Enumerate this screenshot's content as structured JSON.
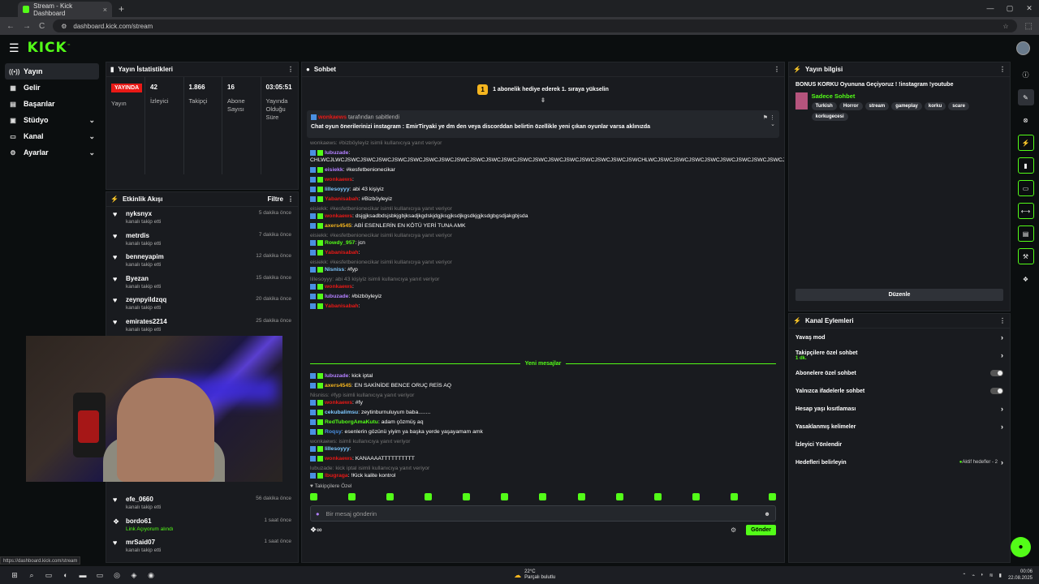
{
  "browser": {
    "tab_title": "Stream - Kick Dashboard",
    "tab_close": "×",
    "new_tab": "+",
    "url": "dashboard.kick.com/stream",
    "status_url": "https://dashboard.kick.com/stream",
    "nav_back": "←",
    "nav_forward": "→",
    "nav_reload": "C",
    "site_info": "⚙",
    "bookmark": "☆",
    "extensions": "⬚",
    "window_controls": [
      "—",
      "▢",
      "✕"
    ]
  },
  "topbar": {
    "menu_glyph": "☰",
    "logo": "KICK",
    "logo_tm": "™"
  },
  "sidebar": {
    "items": [
      {
        "label": "Yayın",
        "icon": "((•))",
        "active": true,
        "chevron": ""
      },
      {
        "label": "Gelir",
        "icon": "▦",
        "active": false,
        "chevron": ""
      },
      {
        "label": "Başarılar",
        "icon": "▤",
        "active": false,
        "chevron": ""
      },
      {
        "label": "Stüdyo",
        "icon": "▣",
        "active": false,
        "chevron": "⌄"
      },
      {
        "label": "Kanal",
        "icon": "▭",
        "active": false,
        "chevron": "⌄"
      },
      {
        "label": "Ayarlar",
        "icon": "⚙",
        "active": false,
        "chevron": "⌄"
      }
    ]
  },
  "stats_panel": {
    "title": "Yayın İstatistikleri",
    "menu_glyph": "⋮",
    "live_badge": "YAYINDA",
    "live_label": "Yayın",
    "stats": [
      {
        "value": "42",
        "label": "İzleyici"
      },
      {
        "value": "1.866",
        "label": "Takipçi"
      },
      {
        "value": "16",
        "label": "Abone Sayısı"
      },
      {
        "value": "03:05:51",
        "label": "Yayında Olduğu Süre"
      }
    ]
  },
  "activity": {
    "title": "Etkinlik Akışı",
    "filter": "Filtre",
    "menu_glyph": "⋮",
    "heart_glyph": "♥",
    "link_glyph": "❖",
    "items_top": [
      {
        "name": "nyksnyx",
        "sub": "kanalı takip etti",
        "time": "5 dakika önce"
      },
      {
        "name": "metrdis",
        "sub": "kanalı takip etti",
        "time": "7 dakika önce"
      },
      {
        "name": "benneyapim",
        "sub": "kanalı takip etti",
        "time": "12 dakika önce"
      },
      {
        "name": "Byezan",
        "sub": "kanalı takip etti",
        "time": "15 dakika önce"
      },
      {
        "name": "zeynpyildzqq",
        "sub": "kanalı takip etti",
        "time": "20 dakika önce"
      },
      {
        "name": "emirates2214",
        "sub": "kanalı takip etti",
        "time": "25 dakika önce"
      }
    ],
    "items_bottom": [
      {
        "name": "efe_0660",
        "sub": "kanalı takip etti",
        "time": "56 dakika önce",
        "link": false
      },
      {
        "name": "bordo61",
        "sub": "Link Açıyorum alındı",
        "time": "1 saat önce",
        "link": true
      },
      {
        "name": "mrSaid07",
        "sub": "kanalı takip etti",
        "time": "1 saat önce",
        "link": false
      }
    ]
  },
  "chat": {
    "title": "Sohbet",
    "menu_glyph": "⋮",
    "gift_banner": "1 abonelik hediye ederek 1. sıraya yükselin",
    "gift_coin": "1",
    "scroll_glyph": "⇟",
    "pinned_by": "tarafından sabitlendi",
    "pinned_user": "wonkaews",
    "pinned_icons": "⚑ ⋮",
    "pinned_expand": "⌄",
    "pinned_text": "Chat oyun önerilerinizi instagram : EmirTiryaki ye dm den veya discorddan belirtin özellikle yeni çıkan oyunlar varsa aklınızda",
    "lines": [
      {
        "reply": "wonkaews: #bizböyleyiz isimli kullanıcıya yanıt veriyor",
        "user": "",
        "color": "#ffffff",
        "text": ""
      },
      {
        "reply": "",
        "user": "lubuzade",
        "color": "#b380ff",
        "text": ": CHLWCJLWCJSWCJSWCJSWCJSWCJSWCJSWCJSWCJSWCJSWCJSWCJSWCJSWCJSWCJSWCJSWCJSWCJSWCJSWCJSWCHLWCJSWCJSWCJSWCJSWCJSWCJSWCJSWCJSWCJSWCJSWCJSWCJSWCJSWCJSWCJSWCJSWCJSWCJSWCJSWCJSWCJSWCJSWCJSWCJSWCJSWCJSWCJSWCJSCW"
      },
      {
        "reply": "",
        "user": "eisiekk",
        "color": "#b380ff",
        "text": ": #kesfetbenionecikar"
      },
      {
        "reply": "",
        "user": "wonkaews",
        "color": "#e91916",
        "text": ":"
      },
      {
        "reply": "",
        "user": "lillesoyyy",
        "color": "#7ec8ff",
        "text": ": abi 43 kişiyiz"
      },
      {
        "reply": "",
        "user": "Yabanisabah",
        "color": "#e91916",
        "text": ": #Bizböyleyiz"
      },
      {
        "reply": "eisiekk: #kesfetbenionecikar isimli kullanıcıya yanıt veriyor",
        "user": "wonkaews",
        "color": "#e91916",
        "text": ": dsjgjksadbdsjsbkjgbjksadjkgdskjdgjksgjksdjkgsdkjgjksdgbgsdjakgbjsda"
      },
      {
        "reply": "",
        "user": "axers4545",
        "color": "#f5b51f",
        "text": ": ABİ ESENLERİN EN KÖTÜ YERİ TUNA AMK"
      },
      {
        "reply": "eisiekk: #kesfetbenionecikar isimli kullanıcıya yanıt veriyor",
        "user": "Rowdy_957",
        "color": "#53fc18",
        "text": ": jcn"
      },
      {
        "reply": "",
        "user": "Yabanisabah",
        "color": "#e91916",
        "text": ":"
      },
      {
        "reply": "eisiekk: #kesfetbenionecikar isimli kullanıcıya yanıt veriyor",
        "user": "Nisniss",
        "color": "#7ec8ff",
        "text": ": #fyp"
      },
      {
        "reply": "lillesoyyy: abi 43 kişiyiz isimli kullanıcıya yanıt veriyor",
        "user": "wonkaews",
        "color": "#e91916",
        "text": ":"
      },
      {
        "reply": "",
        "user": "lubuzade",
        "color": "#b380ff",
        "text": ": #bizböyleyiz"
      },
      {
        "reply": "",
        "user": "Yabanisabah",
        "color": "#e91916",
        "text": ":"
      }
    ],
    "new_messages": "Yeni mesajlar",
    "lines_new": [
      {
        "reply": "",
        "user": "lubuzade",
        "color": "#b380ff",
        "text": ": kick iptal"
      },
      {
        "reply": "",
        "user": "axers4545",
        "color": "#f5b51f",
        "text": ": EN SAKİNİDE BENCE ORUÇ REİS AQ"
      },
      {
        "reply": "Nisniss: #fyp isimli kullanıcıya yanıt veriyor",
        "user": "wonkaews",
        "color": "#e91916",
        "text": ": #fy"
      },
      {
        "reply": "",
        "user": "cekubalimsu",
        "color": "#7ec8ff",
        "text": ": zeytinburnuluyum baba........"
      },
      {
        "reply": "",
        "user": "RedTuborgAmaKutu",
        "color": "#53fc18",
        "text": ": adam çözmüş aq"
      },
      {
        "reply": "",
        "user": "Roqsy",
        "color": "#4a90e2",
        "text": ": esenlerin gözünü yiyim ya başka yerde yaşayamam amk"
      },
      {
        "reply": "wonkaews: isimli kullanıcıya yanıt veriyor",
        "user": "lillesoyyy",
        "color": "#7ec8ff",
        "text": ":"
      },
      {
        "reply": "",
        "user": "wonkaews",
        "color": "#e91916",
        "text": ": KANAAAATTTTTTTTTT"
      },
      {
        "reply": "lubuzade: kick iptal isimli kullanıcıya yanıt veriyor",
        "user": "lbugraga",
        "color": "#e91916",
        "text": ": !Kick kalite kontrol"
      }
    ],
    "followers_only": "Takipçilere Özel",
    "followers_glyph": "♥",
    "input_placeholder": "Bir mesaj gönderin",
    "mic_glyph": "●",
    "emoji_glyph": "☻",
    "points_glyph": "❖∞",
    "settings_glyph": "⚙",
    "send": "Gönder"
  },
  "stream_info": {
    "title": "Yayın bilgisi",
    "menu_glyph": "⋮",
    "stream_title": "BONUS KORKU Oyununa Geçiyoruz ! !instagram !youtube",
    "category": "Sadece Sohbet",
    "tags": [
      "Turkish",
      "Horror",
      "stream",
      "gameplay",
      "korku",
      "scare",
      "korkugecesi"
    ],
    "edit": "Düzenle"
  },
  "channel_actions": {
    "title": "Kanal Eylemleri",
    "menu_glyph": "⋮",
    "goals_text": "Aktif hedefler - 2",
    "goals_dot": "●",
    "items": [
      {
        "label": "Yavaş mod",
        "type": "chevron",
        "sub": ""
      },
      {
        "label": "Takipçilere özel sohbet",
        "type": "chevron",
        "sub": "1 dk."
      },
      {
        "label": "Abonelere özel sohbet",
        "type": "toggle",
        "sub": ""
      },
      {
        "label": "Yalnızca ifadelerle sohbet",
        "type": "toggle",
        "sub": ""
      },
      {
        "label": "Hesap yaşı kısıtlaması",
        "type": "chevron",
        "sub": ""
      },
      {
        "label": "Yasaklanmış kelimeler",
        "type": "chevron",
        "sub": ""
      },
      {
        "label": "İzleyici Yönlendir",
        "type": "none",
        "sub": ""
      },
      {
        "label": "Hedefleri belirleyin",
        "type": "goals",
        "sub": ""
      }
    ]
  },
  "rail": [
    "ⓘ",
    "✎",
    "⊗",
    "⚡",
    "▮",
    "▭",
    "⟷",
    "▤",
    "⚒",
    "❖"
  ],
  "taskbar": {
    "weather_temp": "22°C",
    "weather_text": "Parçalı bulutlu",
    "time": "00:06",
    "date": "22.08.2025",
    "icons": [
      "⊞",
      "⌕",
      "▭",
      "◐",
      "▬",
      "▭",
      "◎",
      "◈",
      "◉"
    ],
    "tray_icons": [
      "⌃",
      "⌁",
      "◗",
      "≋",
      "▮"
    ]
  },
  "colors": {
    "accent": "#53fc18",
    "live": "#e91916",
    "panel": "#191b1f"
  }
}
